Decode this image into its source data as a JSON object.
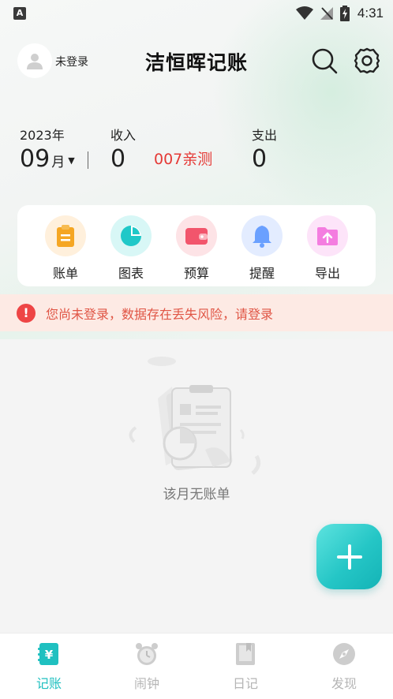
{
  "status_bar": {
    "time": "4:31",
    "left_icon": "A"
  },
  "header": {
    "login_label": "未登录",
    "title": "洁恒晖记账"
  },
  "summary": {
    "year": "2023年",
    "month": "09",
    "month_unit": "月",
    "income_label": "收入",
    "income_value": "0",
    "promo": "007亲测",
    "expense_label": "支出",
    "expense_value": "0"
  },
  "quick_actions": [
    {
      "label": "账单",
      "icon": "bill-icon",
      "color": "#f5a623"
    },
    {
      "label": "图表",
      "icon": "chart-icon",
      "color": "#1fc8c8"
    },
    {
      "label": "预算",
      "icon": "wallet-icon",
      "color": "#f2556c"
    },
    {
      "label": "提醒",
      "icon": "bell-icon",
      "color": "#6aa0ff"
    },
    {
      "label": "导出",
      "icon": "export-icon",
      "color": "#f47de0"
    }
  ],
  "warning": {
    "text": "您尚未登录，数据存在丢失风险，请登录"
  },
  "empty": {
    "text": "该月无账单"
  },
  "nav": [
    {
      "label": "记账",
      "icon": "ledger-icon",
      "active": true
    },
    {
      "label": "闹钟",
      "icon": "alarm-icon",
      "active": false
    },
    {
      "label": "日记",
      "icon": "diary-icon",
      "active": false
    },
    {
      "label": "发现",
      "icon": "compass-icon",
      "active": false
    }
  ],
  "colors": {
    "accent": "#1fc0c0",
    "warning": "#e05545",
    "promo": "#e53935"
  }
}
